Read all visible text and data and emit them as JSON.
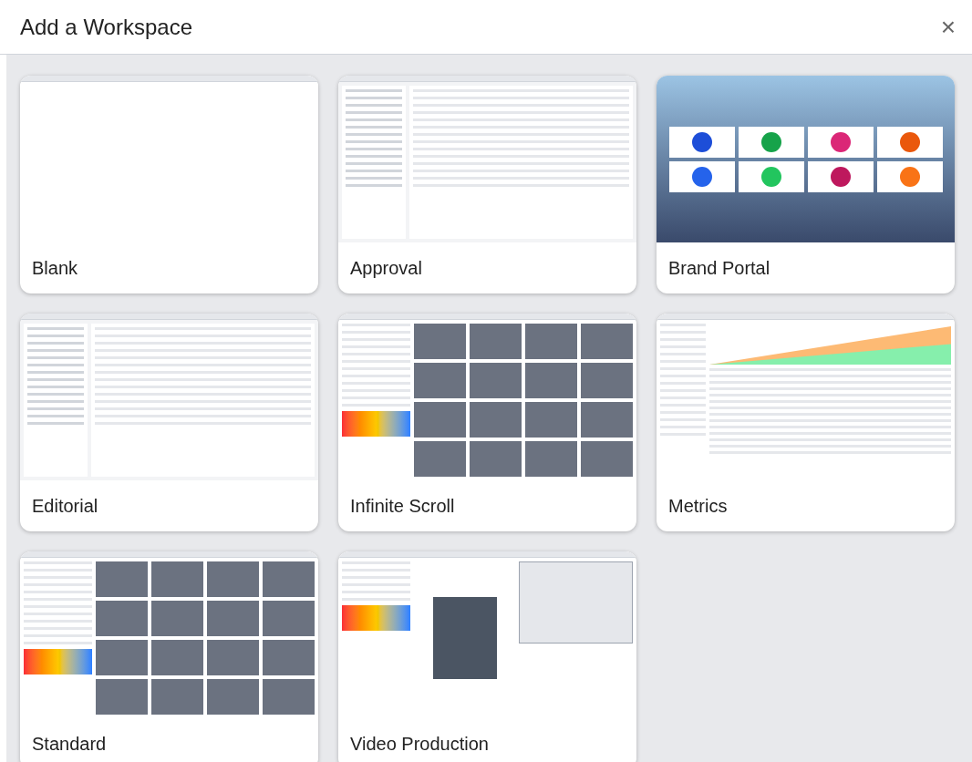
{
  "dialog": {
    "title": "Add a Workspace",
    "close": "×"
  },
  "workspaces": [
    {
      "label": "Blank",
      "kind": "blank"
    },
    {
      "label": "Approval",
      "kind": "table"
    },
    {
      "label": "Brand Portal",
      "kind": "portal"
    },
    {
      "label": "Editorial",
      "kind": "table"
    },
    {
      "label": "Infinite Scroll",
      "kind": "grid"
    },
    {
      "label": "Metrics",
      "kind": "chart"
    },
    {
      "label": "Standard",
      "kind": "grid"
    },
    {
      "label": "Video Production",
      "kind": "editor"
    }
  ]
}
